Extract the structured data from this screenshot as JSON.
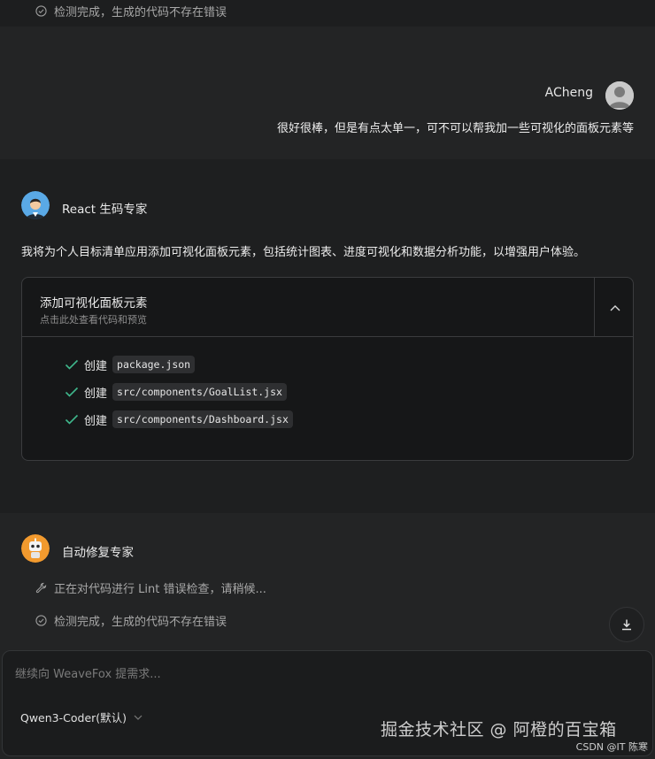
{
  "top_status": {
    "text": "检测完成，生成的代码不存在错误"
  },
  "user_message": {
    "name": "ACheng",
    "text": "很好很棒，但是有点太单一，可不可以帮我加一些可视化的面板元素等"
  },
  "assistant": {
    "name": "React 生码专家",
    "message": "我将为个人目标清单应用添加可视化面板元素，包括统计图表、进度可视化和数据分析功能，以增强用户体验。",
    "card": {
      "title": "添加可视化面板元素",
      "subtitle": "点击此处查看代码和预览",
      "files": [
        {
          "action": "创建",
          "path": "package.json"
        },
        {
          "action": "创建",
          "path": "src/components/GoalList.jsx"
        },
        {
          "action": "创建",
          "path": "src/components/Dashboard.jsx"
        }
      ]
    }
  },
  "fixer": {
    "name": "自动修复专家",
    "progress": "正在对代码进行 Lint 错误检查，请稍候...",
    "status": "检测完成，生成的代码不存在错误"
  },
  "composer": {
    "placeholder": "继续向 WeaveFox 提需求...",
    "model": "Qwen3-Coder(默认)"
  },
  "watermark": {
    "main": "掘金技术社区 @ 阿橙的百宝箱",
    "csdn": "CSDN @IT 陈寒"
  },
  "colors": {
    "check_green": "#3fb68b",
    "background": "#222324",
    "card": "#161718"
  }
}
